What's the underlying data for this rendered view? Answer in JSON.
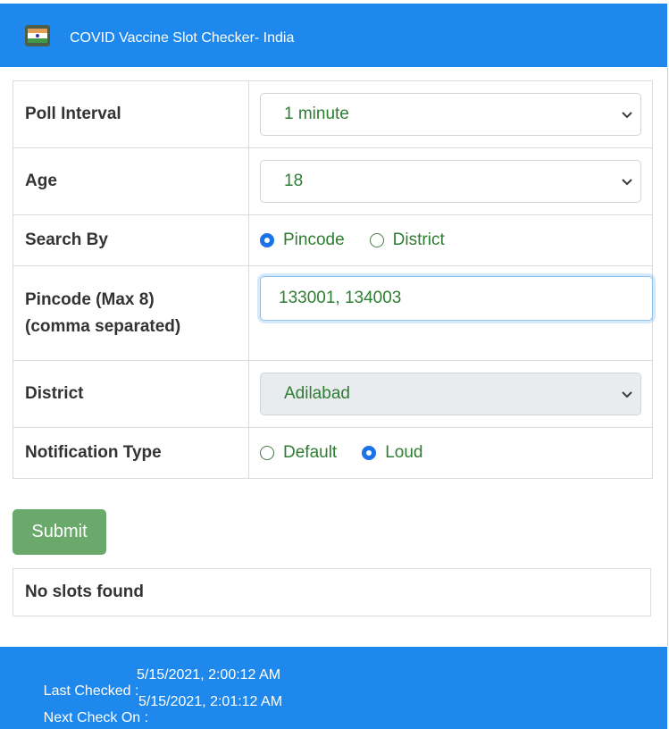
{
  "header": {
    "title": "COVID Vaccine Slot Checker- India",
    "logo_icon": "india-flag-icon"
  },
  "form": {
    "poll_interval": {
      "label": "Poll Interval",
      "selected": "1 minute"
    },
    "age": {
      "label": "Age",
      "selected": "18"
    },
    "search_by": {
      "label": "Search By",
      "options": [
        "Pincode",
        "District"
      ],
      "selected": "Pincode"
    },
    "pincode": {
      "label_line1": "Pincode (Max 8)",
      "label_line2": "(comma separated)",
      "value": "133001, 134003"
    },
    "district": {
      "label": "District",
      "selected": "Adilabad",
      "disabled": true
    },
    "notification_type": {
      "label": "Notification Type",
      "options": [
        "Default",
        "Loud"
      ],
      "selected": "Loud"
    }
  },
  "submit_label": "Submit",
  "result_text": "No slots found",
  "footer": {
    "last_checked_label": "Last Checked :",
    "last_checked_value": "5/15/2021, 2:00:12 AM",
    "next_check_label": "Next Check On :",
    "next_check_value": "5/15/2021, 2:01:12 AM"
  },
  "colors": {
    "brand_blue": "#1e88ec",
    "submit_green": "#6aa86c",
    "value_green": "#2e7d32",
    "radio_checked": "#1a73e8"
  }
}
